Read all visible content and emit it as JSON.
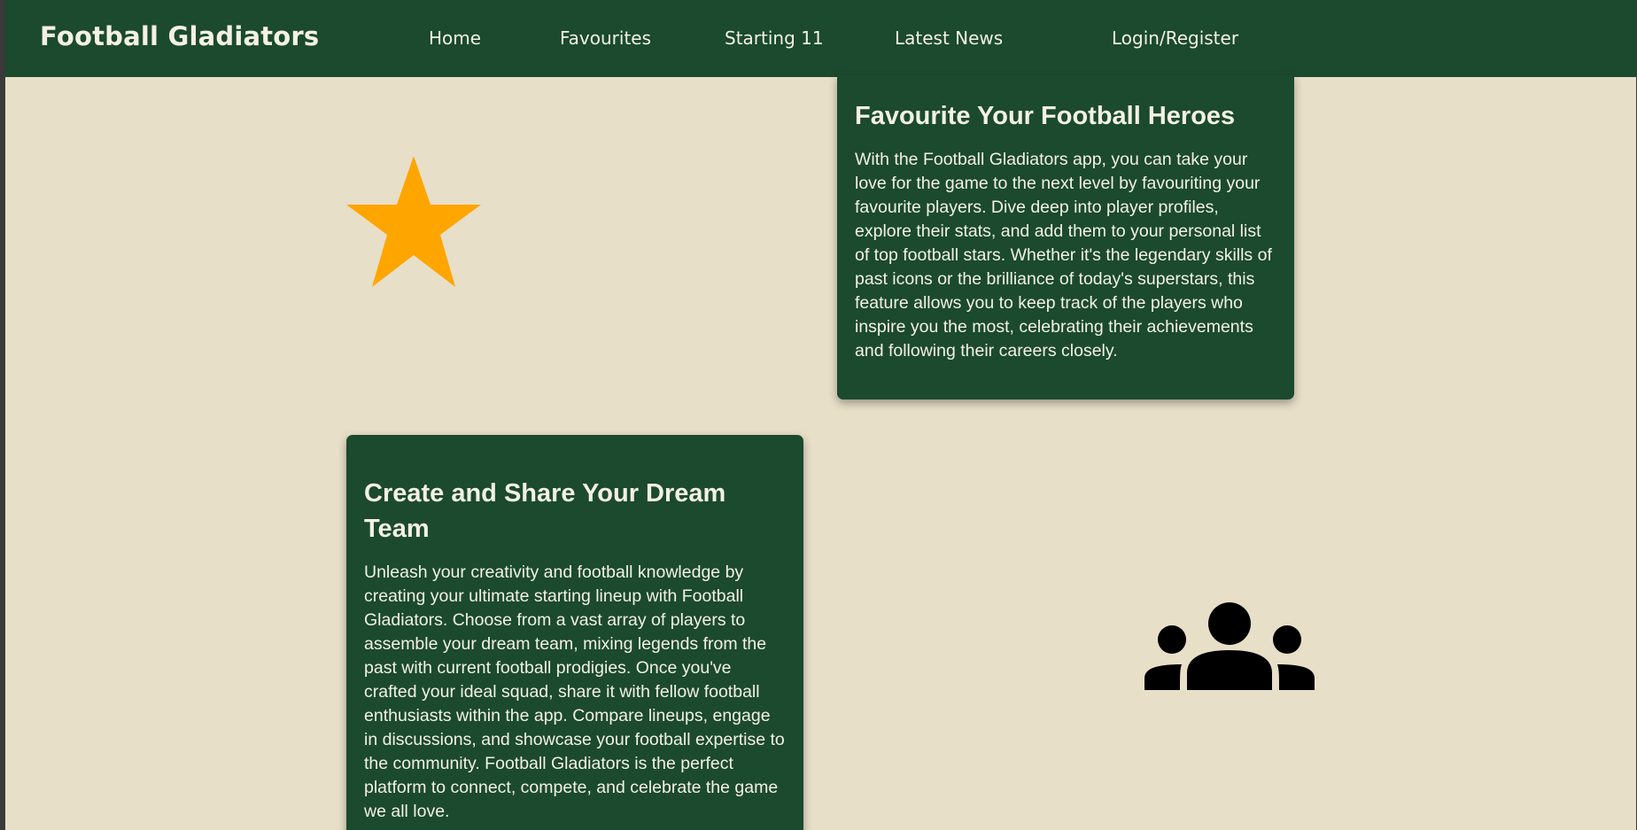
{
  "header": {
    "brand": "Football Gladiators",
    "nav": {
      "home": "Home",
      "favourites": "Favourites",
      "starting11": "Starting 11",
      "latest_news": "Latest News",
      "login": "Login/Register"
    }
  },
  "features": {
    "favourites": {
      "icon": "star-icon",
      "title": "Favourite Your Football Heroes",
      "body": "With the Football Gladiators app, you can take your love for the game to the next level by favouriting your favourite players. Dive deep into player profiles, explore their stats, and add them to your personal list of top football stars. Whether it's the legendary skills of past icons or the brilliance of today's superstars, this feature allows you to keep track of the players who inspire you the most, celebrating their achievements and following their careers closely."
    },
    "dream_team": {
      "icon": "group-icon",
      "title": "Create and Share Your Dream Team",
      "body": "Unleash your creativity and football knowledge by creating your ultimate starting lineup with Football Gladiators. Choose from a vast array of players to assemble your dream team, mixing legends from the past with current football prodigies. Once you've crafted your ideal squad, share it with fellow football enthusiasts within the app. Compare lineups, engage in discussions, and showcase your football expertise to the community. Football Gladiators is the perfect platform to connect, compete, and celebrate the game we all love."
    }
  },
  "colors": {
    "nav_background": "#1b4a2e",
    "page_background": "#e8dfc8",
    "card_background": "#1b4a2e",
    "text_light": "#f4f1e4",
    "star": "#ffa500",
    "group_icon": "#000000"
  }
}
